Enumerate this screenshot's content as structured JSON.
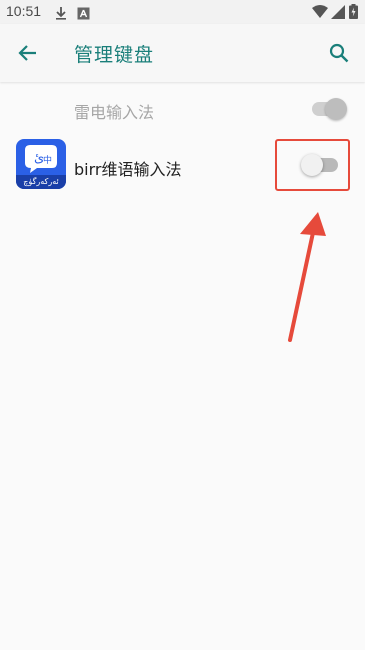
{
  "status_bar": {
    "time": "10:51",
    "icons": [
      "download-icon",
      "a-box-icon",
      "wifi-icon",
      "signal-icon",
      "battery-icon"
    ]
  },
  "app_bar": {
    "title": "管理键盘",
    "back_icon": "arrow-left-icon",
    "search_icon": "search-icon",
    "accent_color": "#1a7f7a"
  },
  "keyboards": [
    {
      "label": "雷电输入法",
      "enabled": true,
      "disabled_look": true
    },
    {
      "label": "birr维语输入法",
      "enabled": false,
      "icon_caption": "ئەركەرگۈچ"
    }
  ],
  "annotation": {
    "highlight_color": "#e64a3b"
  }
}
